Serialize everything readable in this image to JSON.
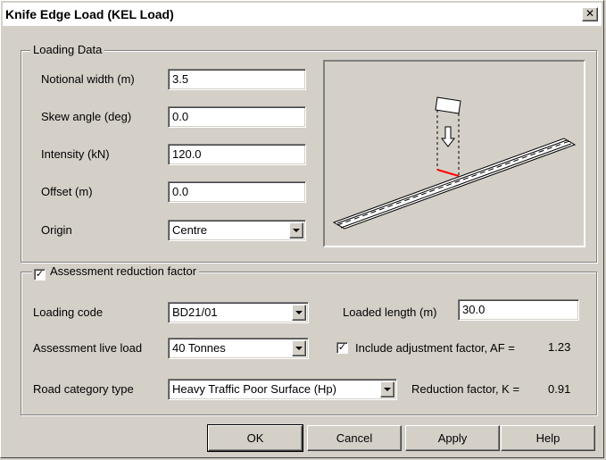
{
  "window": {
    "title": "Knife Edge Load (KEL Load)",
    "close_glyph": "✕"
  },
  "loading_data": {
    "group_label": "Loading Data",
    "notional_width": {
      "label": "Notional width (m)",
      "value": "3.5"
    },
    "skew_angle": {
      "label": "Skew angle (deg)",
      "value": "0.0"
    },
    "intensity": {
      "label": "Intensity (kN)",
      "value": "120.0"
    },
    "offset": {
      "label": "Offset (m)",
      "value": "0.0"
    },
    "origin": {
      "label": "Origin",
      "value": "Centre"
    }
  },
  "assessment": {
    "group_label": "Assessment reduction factor",
    "enabled": true,
    "loading_code": {
      "label": "Loading code",
      "value": "BD21/01"
    },
    "loaded_length": {
      "label": "Loaded length (m)",
      "value": "30.0"
    },
    "live_load": {
      "label": "Assessment live load",
      "value": "40 Tonnes"
    },
    "include_af": {
      "label": "Include adjustment factor, AF =",
      "checked": true,
      "value": "1.23"
    },
    "road_category": {
      "label": "Road category type",
      "value": "Heavy Traffic Poor Surface (Hp)"
    },
    "reduction_factor": {
      "label": "Reduction factor, K =",
      "value": "0.91"
    }
  },
  "buttons": {
    "ok": "OK",
    "cancel": "Cancel",
    "apply": "Apply",
    "help": "Help"
  },
  "colors": {
    "load_line": "#ff0000",
    "background": "#d4d0c8"
  }
}
